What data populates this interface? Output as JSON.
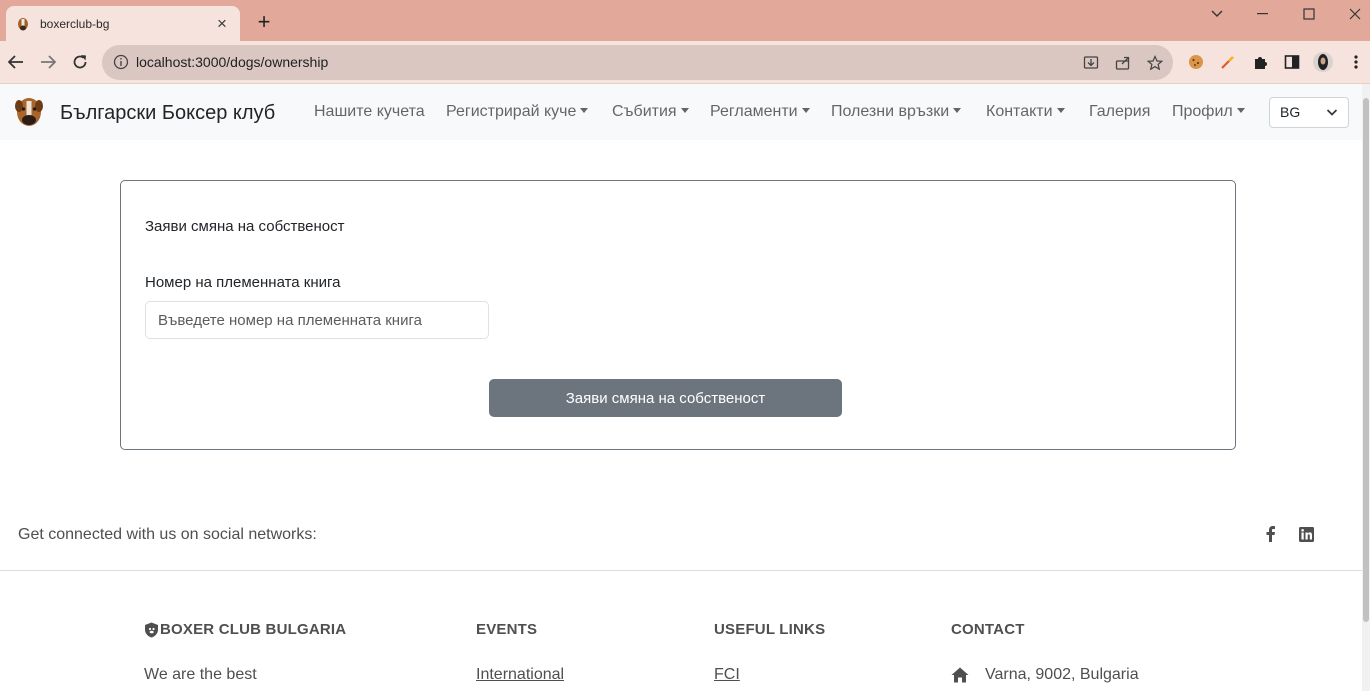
{
  "browser": {
    "tab_title": "boxerclub-bg",
    "url": "localhost:3000/dogs/ownership",
    "new_tab_symbol": "+",
    "tab_close_symbol": "×"
  },
  "navbar": {
    "brand": "Български Боксер клуб",
    "links": [
      {
        "label": "Нашите кучета",
        "dropdown": false
      },
      {
        "label": "Регистрирай куче",
        "dropdown": true
      },
      {
        "label": "Събития",
        "dropdown": true
      },
      {
        "label": "Регламенти",
        "dropdown": true
      },
      {
        "label": "Полезни връзки",
        "dropdown": true
      },
      {
        "label": "Контакти",
        "dropdown": true
      },
      {
        "label": "Галерия",
        "dropdown": false
      },
      {
        "label": "Профил",
        "dropdown": true
      }
    ],
    "language": "BG"
  },
  "form": {
    "title": "Заяви смяна на собственост",
    "field_label": "Номер на племенната книга",
    "field_placeholder": "Въведете номер на племенната книга",
    "field_value": "",
    "submit_label": "Заяви смяна на собственост"
  },
  "footer": {
    "social_text": "Get connected with us on social networks:",
    "social_icons": [
      "facebook-icon",
      "linkedin-icon"
    ],
    "columns": {
      "about": {
        "heading": "BOXER CLUB BULGARIA",
        "text": "We are the best"
      },
      "events": {
        "heading": "EVENTS",
        "link": "International"
      },
      "useful": {
        "heading": "USEFUL LINKS",
        "link": "FCI"
      },
      "contact": {
        "heading": "CONTACT",
        "address": "Varna, 9002, Bulgaria"
      }
    }
  },
  "colors": {
    "tabstrip": "#e2a99b",
    "toolbar": "#f7e3dd",
    "navbar_bg": "#f8f9fa",
    "button_bg": "#6c757d",
    "card_border": "#6c757d"
  }
}
